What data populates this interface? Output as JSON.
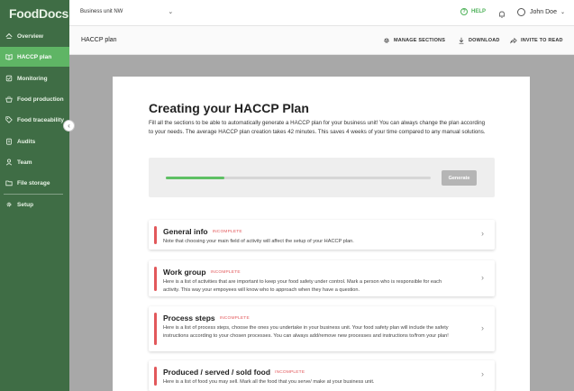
{
  "app": {
    "logo": "FoodDocs"
  },
  "sidebar": {
    "items": [
      {
        "label": "Overview",
        "icon": "overview-icon"
      },
      {
        "label": "HACCP plan",
        "icon": "book-icon"
      },
      {
        "label": "Monitoring",
        "icon": "monitoring-icon"
      },
      {
        "label": "Food production",
        "icon": "food-production-icon"
      },
      {
        "label": "Food traceability",
        "icon": "tag-icon"
      },
      {
        "label": "Audits",
        "icon": "clipboard-icon"
      },
      {
        "label": "Team",
        "icon": "user-icon"
      },
      {
        "label": "File storage",
        "icon": "folder-icon"
      },
      {
        "label": "Setup",
        "icon": "gear-icon"
      }
    ],
    "active": "HACCP plan",
    "collapse_glyph": "‹"
  },
  "topbar": {
    "business_unit": "Business unit NW",
    "help_label": "HELP",
    "user_name": "John Doe"
  },
  "subbar": {
    "title": "HACCP plan",
    "manage_sections": "MANAGE SECTIONS",
    "download": "DOWNLOAD",
    "invite": "INVITE TO READ"
  },
  "main": {
    "heading": "Creating your HACCP Plan",
    "intro": "Fill all the sections to be able to automatically generate a HACCP plan for your business unit! You can always change the plan according to your needs. The average HACCP plan creation takes 42 minutes. This saves 4 weeks of your time compared to any manual solutions.",
    "progress_fraction": 0.22,
    "generate_label": "Generate",
    "sections": [
      {
        "title": "General info",
        "status": "INCOMPLETE",
        "description": "Note that choosing your main field of activity will affect the setup of your HACCP plan."
      },
      {
        "title": "Work group",
        "status": "INCOMPLETE",
        "description": "Here is a list of activities that are important to keep your food safety under control. Mark a person who is responsible for each activity. This way your empoyees will know who to approach when they have a question."
      },
      {
        "title": "Process steps",
        "status": "INCOMPLETE",
        "description": "Here is a list of process steps, choose the ones you undertake in your business unit. Your food safety plan will include the safety instructions according to your chosen processes. You can always add/remove new processes and instructions to/from your plan!"
      },
      {
        "title": "Produced / served / sold food",
        "status": "INCOMPLETE",
        "description": "Here is a list of food you may sell. Mark all the food that you serve/ make at your business unit."
      }
    ]
  },
  "colors": {
    "sidebar_bg": "#3f6d45",
    "active_item": "#5fb565",
    "accent_green": "#4fb25a",
    "incomplete_red": "#e2585b"
  }
}
